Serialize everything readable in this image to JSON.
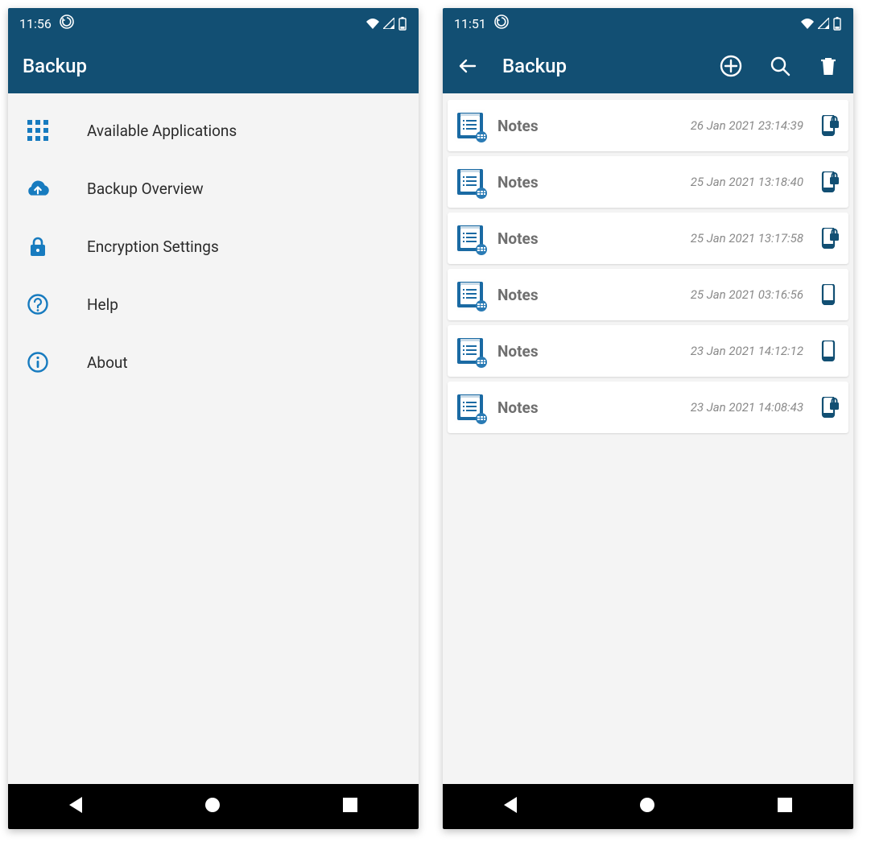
{
  "left": {
    "status": {
      "time": "11:56"
    },
    "app_bar": {
      "title": "Backup"
    },
    "menu": [
      {
        "icon": "apps",
        "label": "Available Applications"
      },
      {
        "icon": "cloud-upload",
        "label": "Backup Overview"
      },
      {
        "icon": "lock",
        "label": "Encryption Settings"
      },
      {
        "icon": "help",
        "label": "Help"
      },
      {
        "icon": "about",
        "label": "About"
      }
    ]
  },
  "right": {
    "status": {
      "time": "11:51"
    },
    "app_bar": {
      "title": "Backup"
    },
    "backups": [
      {
        "name": "Notes",
        "timestamp": "26 Jan 2021 23:14:39",
        "locked": true
      },
      {
        "name": "Notes",
        "timestamp": "25 Jan 2021 13:18:40",
        "locked": true
      },
      {
        "name": "Notes",
        "timestamp": "25 Jan 2021 13:17:58",
        "locked": true
      },
      {
        "name": "Notes",
        "timestamp": "25 Jan 2021 03:16:56",
        "locked": false
      },
      {
        "name": "Notes",
        "timestamp": "23 Jan 2021 14:12:12",
        "locked": false
      },
      {
        "name": "Notes",
        "timestamp": "23 Jan 2021 14:08:43",
        "locked": true
      }
    ]
  },
  "colors": {
    "primary": "#124f73",
    "accent_blue": "#177bbf"
  }
}
